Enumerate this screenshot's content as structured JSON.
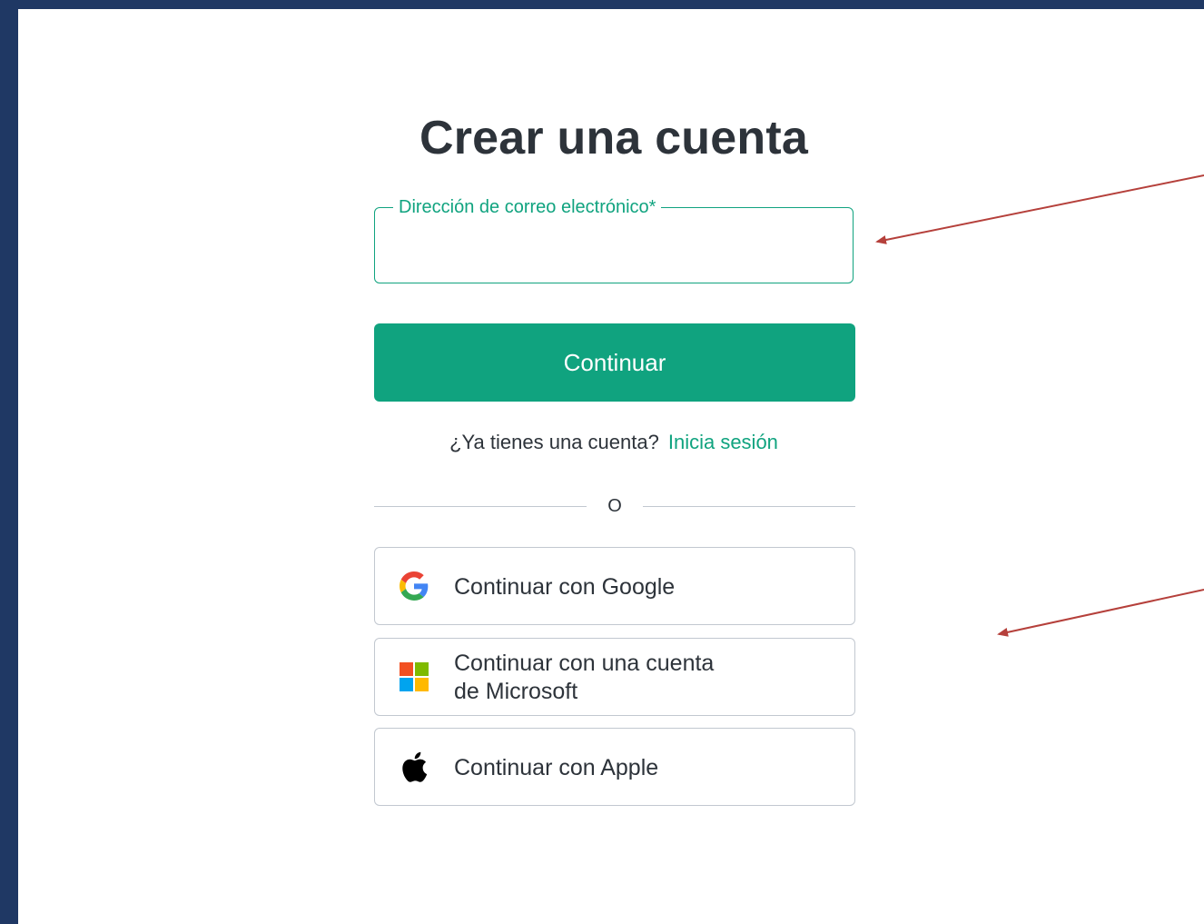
{
  "page": {
    "title": "Crear una cuenta"
  },
  "email_field": {
    "label": "Dirección de correo electrónico*",
    "value": ""
  },
  "primary_button": {
    "label": "Continuar"
  },
  "signin": {
    "prompt": "¿Ya tienes una cuenta?",
    "link": "Inicia sesión"
  },
  "divider": {
    "text": "O"
  },
  "social": [
    {
      "label": "Continuar con Google",
      "icon": "google-icon"
    },
    {
      "label": "Continuar con una cuenta de Microsoft",
      "icon": "microsoft-icon"
    },
    {
      "label": "Continuar con Apple",
      "icon": "apple-icon"
    }
  ],
  "colors": {
    "accent": "#10a37f",
    "frame_border": "#1f3864",
    "annotation_arrow": "#b5403b"
  }
}
